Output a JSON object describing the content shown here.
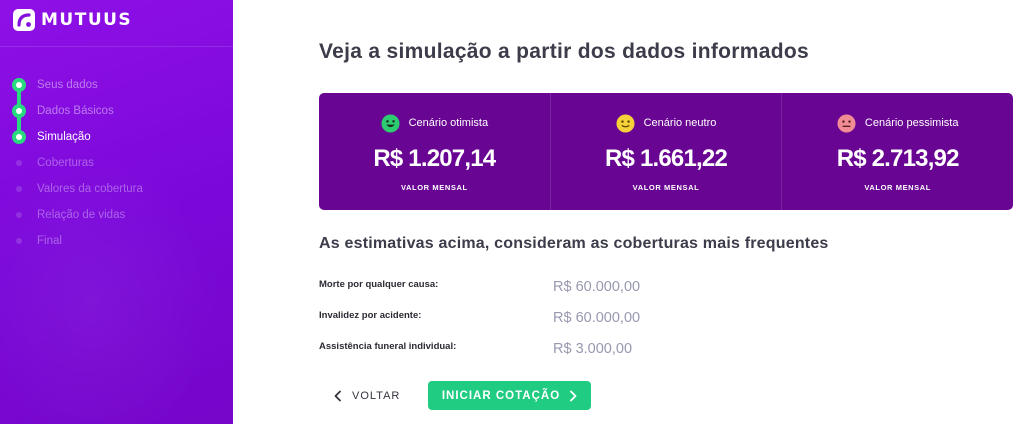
{
  "brand": {
    "name": "MUTUUS",
    "logo_icon": "mutuus-logo-icon"
  },
  "steps": [
    {
      "label": "Seus dados",
      "state": "done"
    },
    {
      "label": "Dados Básicos",
      "state": "done"
    },
    {
      "label": "Simulação",
      "state": "active"
    },
    {
      "label": "Coberturas",
      "state": "pending"
    },
    {
      "label": "Valores da cobertura",
      "state": "pending"
    },
    {
      "label": "Relação de vidas",
      "state": "pending"
    },
    {
      "label": "Final",
      "state": "pending"
    }
  ],
  "main": {
    "title": "Veja a simulação a partir dos dados informados",
    "scenarios": [
      {
        "name": "Cenário otimista",
        "value": "R$ 1.207,14",
        "caption": "VALOR MENSAL",
        "icon": "smiling-face-icon",
        "color": "#2ecc71"
      },
      {
        "name": "Cenário neutro",
        "value": "R$ 1.661,22",
        "caption": "VALOR MENSAL",
        "icon": "neutral-face-icon",
        "color": "#f7d13a"
      },
      {
        "name": "Cenário pessimista",
        "value": "R$ 2.713,92",
        "caption": "VALOR MENSAL",
        "icon": "sad-face-icon",
        "color": "#f18c95"
      }
    ],
    "subtitle": "As estimativas acima, consideram as coberturas mais frequentes",
    "coverages": [
      {
        "name": "Morte por qualquer causa:",
        "value": "R$ 60.000,00"
      },
      {
        "name": "Invalidez por acidente:",
        "value": "R$ 60.000,00"
      },
      {
        "name": "Assistência funeral individual:",
        "value": "R$ 3.000,00"
      }
    ],
    "actions": {
      "back_label": "VOLTAR",
      "start_label": "INICIAR COTAÇÃO"
    }
  },
  "colors": {
    "sidebar": "#8410e0",
    "accent_green": "#1fcc82",
    "panel": "#690593"
  }
}
